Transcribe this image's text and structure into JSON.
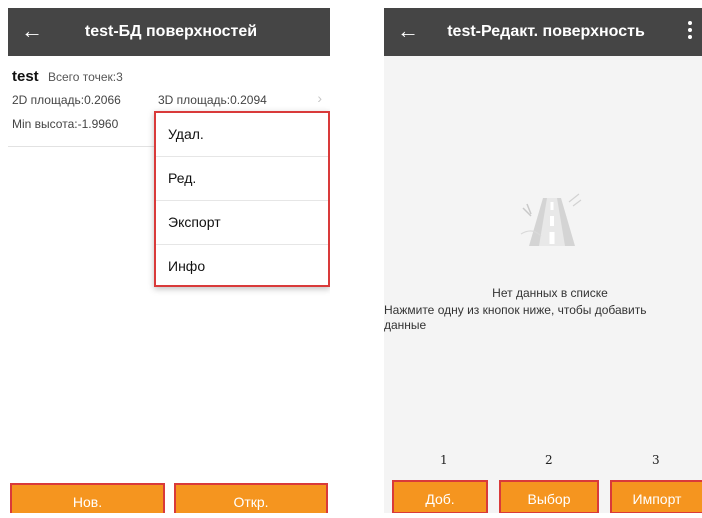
{
  "left_screen": {
    "title": "test-БД поверхностей",
    "back_icon": "←",
    "item": {
      "name": "test",
      "points_label": "Всего точек:3",
      "area_2d": "2D площадь:0.2066",
      "area_3d": "3D площадь:0.2094",
      "min_height": "Min высота:-1.9960",
      "chevron": "›"
    },
    "context_menu": [
      {
        "label": "Удал."
      },
      {
        "label": "Ред."
      },
      {
        "label": "Экспорт"
      },
      {
        "label": "Инфо"
      }
    ],
    "buttons": {
      "new": "Нов.",
      "open": "Откр."
    }
  },
  "right_screen": {
    "title": "test-Редакт. поверхность",
    "back_icon": "←",
    "empty_state": {
      "title": "Нет данных в списке",
      "hint": "Нажмите одну из кнопок ниже, чтобы добавить данные"
    },
    "step_numbers": [
      "1",
      "2",
      "3"
    ],
    "buttons": {
      "add": "Доб.",
      "select": "Выбор",
      "import": "Импорт"
    }
  },
  "colors": {
    "appbar": "#454545",
    "button": "#f5951f",
    "highlight_border": "#d93a3a"
  },
  "icons": [
    "back-arrow-icon",
    "more-vert-icon",
    "chevron-right-icon",
    "empty-road-icon"
  ]
}
